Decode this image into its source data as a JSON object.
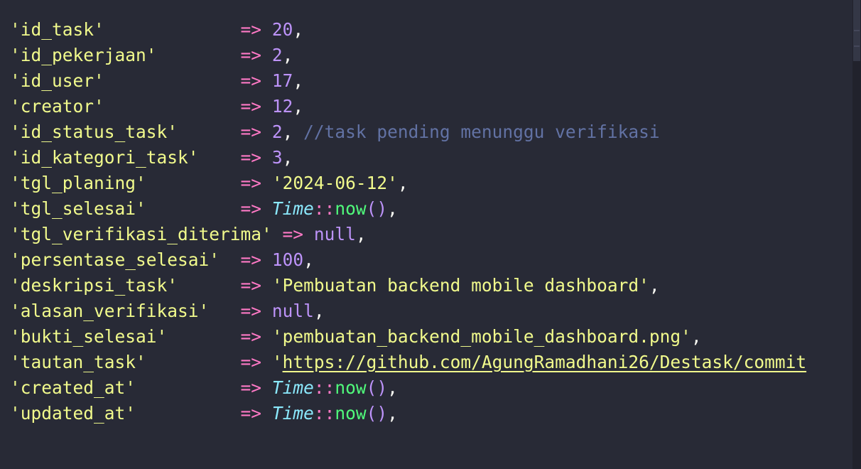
{
  "lines": [
    {
      "key": "'id_task'",
      "pad": "             ",
      "arrow": "=>",
      "value": "20",
      "type": "num"
    },
    {
      "key": "'id_pekerjaan'",
      "pad": "        ",
      "arrow": "=>",
      "value": "2",
      "type": "num"
    },
    {
      "key": "'id_user'",
      "pad": "             ",
      "arrow": "=>",
      "value": "17",
      "type": "num"
    },
    {
      "key": "'creator'",
      "pad": "             ",
      "arrow": "=>",
      "value": "12",
      "type": "num"
    },
    {
      "key": "'id_status_task'",
      "pad": "      ",
      "arrow": "=>",
      "value": "2",
      "type": "num",
      "comment": "//task pending menunggu verifikasi"
    },
    {
      "key": "'id_kategori_task'",
      "pad": "    ",
      "arrow": "=>",
      "value": "3",
      "type": "num"
    },
    {
      "key": "'tgl_planing'",
      "pad": "         ",
      "arrow": "=>",
      "value": "'2024-06-12'",
      "type": "str"
    },
    {
      "key": "'tgl_selesai'",
      "pad": "         ",
      "arrow": "=>",
      "value": "Time::now()",
      "type": "call"
    },
    {
      "key": "'tgl_verifikasi_diterima'",
      "pad": " ",
      "arrow": "=>",
      "value": "null",
      "type": "null"
    },
    {
      "key": "'persentase_selesai'",
      "pad": "  ",
      "arrow": "=>",
      "value": "100",
      "type": "num"
    },
    {
      "key": "'deskripsi_task'",
      "pad": "      ",
      "arrow": "=>",
      "value": "'Pembuatan backend mobile dashboard'",
      "type": "str"
    },
    {
      "key": "'alasan_verifikasi'",
      "pad": "   ",
      "arrow": "=>",
      "value": "null",
      "type": "null"
    },
    {
      "key": "'bukti_selesai'",
      "pad": "       ",
      "arrow": "=>",
      "value": "'pembuatan_backend_mobile_dashboard.png'",
      "type": "str"
    },
    {
      "key": "'tautan_task'",
      "pad": "         ",
      "arrow": "=>",
      "value": "'https://github.com/AgungRamadhani26/Destask/commit",
      "type": "link"
    },
    {
      "key": "'created_at'",
      "pad": "          ",
      "arrow": "=>",
      "value": "Time::now()",
      "type": "call"
    },
    {
      "key": "'updated_at'",
      "pad": "          ",
      "arrow": "=>",
      "value": "Time::now()",
      "type": "call"
    }
  ],
  "colors": {
    "background": "#282a36",
    "string": "#f1fa8c",
    "operator": "#ff79c6",
    "number": "#bd93f9",
    "comment": "#6272a4",
    "class": "#8be9fd",
    "function": "#50fa7b"
  }
}
